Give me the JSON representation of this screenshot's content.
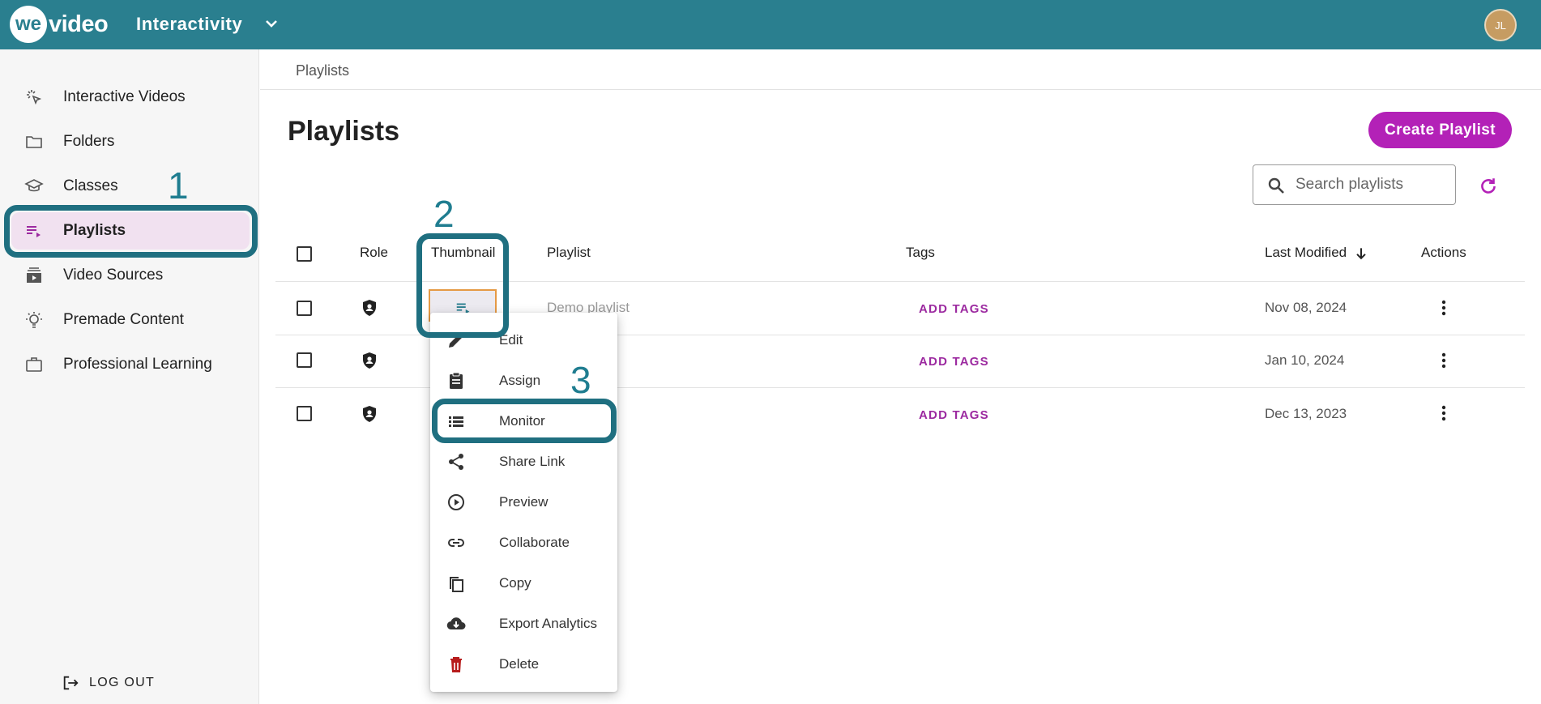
{
  "header": {
    "logo_we": "we",
    "logo_rest": "video",
    "app_title": "Interactivity",
    "avatar_initials": "JL",
    "bar_color": "#2a7f8f"
  },
  "sidebar": {
    "items": [
      {
        "label": "Interactive Videos",
        "icon": "cursor-click-icon"
      },
      {
        "label": "Folders",
        "icon": "folder-icon"
      },
      {
        "label": "Classes",
        "icon": "graduation-cap-icon"
      },
      {
        "label": "Playlists",
        "icon": "playlist-play-icon",
        "active": true
      },
      {
        "label": "Video Sources",
        "icon": "video-stack-icon"
      },
      {
        "label": "Premade Content",
        "icon": "lightbulb-icon"
      },
      {
        "label": "Professional Learning",
        "icon": "briefcase-icon"
      }
    ],
    "logout_label": "LOG OUT"
  },
  "annotations": {
    "n1": "1",
    "n2": "2",
    "n3": "3",
    "color": "#1f6f80"
  },
  "breadcrumb": "Playlists",
  "page": {
    "title": "Playlists",
    "create_button": "Create Playlist",
    "search_placeholder": "Search playlists",
    "accent": "#b321b7"
  },
  "table": {
    "columns": {
      "role": "Role",
      "thumbnail": "Thumbnail",
      "playlist": "Playlist",
      "tags": "Tags",
      "last_modified": "Last Modified",
      "actions": "Actions"
    },
    "rows": [
      {
        "name": "Demo playlist",
        "tags": "ADD TAGS",
        "date": "Nov 08, 2024"
      },
      {
        "name": "",
        "tags": "ADD TAGS",
        "date": "Jan 10, 2024"
      },
      {
        "name": "",
        "tags": "ADD TAGS",
        "date": "Dec 13, 2023"
      }
    ]
  },
  "context_menu": {
    "items": [
      {
        "label": "Edit",
        "icon": "pencil-icon"
      },
      {
        "label": "Assign",
        "icon": "clipboard-icon"
      },
      {
        "label": "Monitor",
        "icon": "list-icon"
      },
      {
        "label": "Share Link",
        "icon": "share-icon"
      },
      {
        "label": "Preview",
        "icon": "play-circle-icon"
      },
      {
        "label": "Collaborate",
        "icon": "link-icon"
      },
      {
        "label": "Copy",
        "icon": "copy-icon"
      },
      {
        "label": "Export Analytics",
        "icon": "cloud-download-icon"
      },
      {
        "label": "Delete",
        "icon": "trash-icon",
        "color": "#b71c1c"
      }
    ]
  }
}
